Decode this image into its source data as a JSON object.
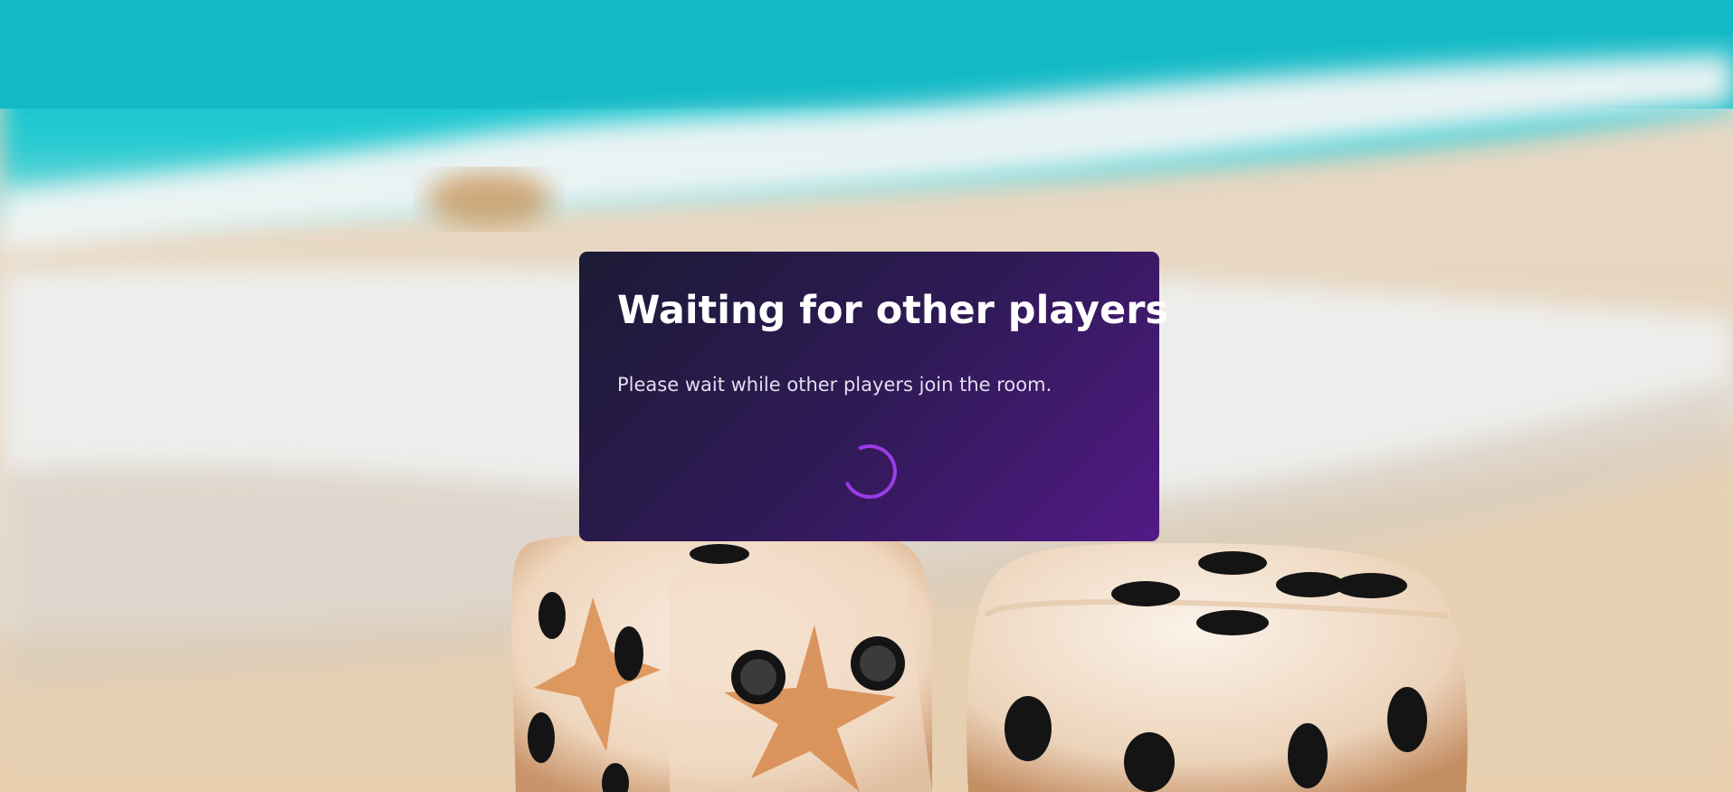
{
  "waiting_dialog": {
    "title": "Waiting for other players",
    "message": "Please wait while other players join the room.",
    "spinner_color": "#9b3ce6",
    "background_gradient": [
      "#1c1a35",
      "#531a86"
    ]
  },
  "background": {
    "description_icon": "beach-dice-background",
    "colors": {
      "sea": "#1fc7cf",
      "foam": "#f4f4f2",
      "sand": "#e8d4b8",
      "dice": "#f3e4d2",
      "pips": "#1a1a1a"
    }
  }
}
